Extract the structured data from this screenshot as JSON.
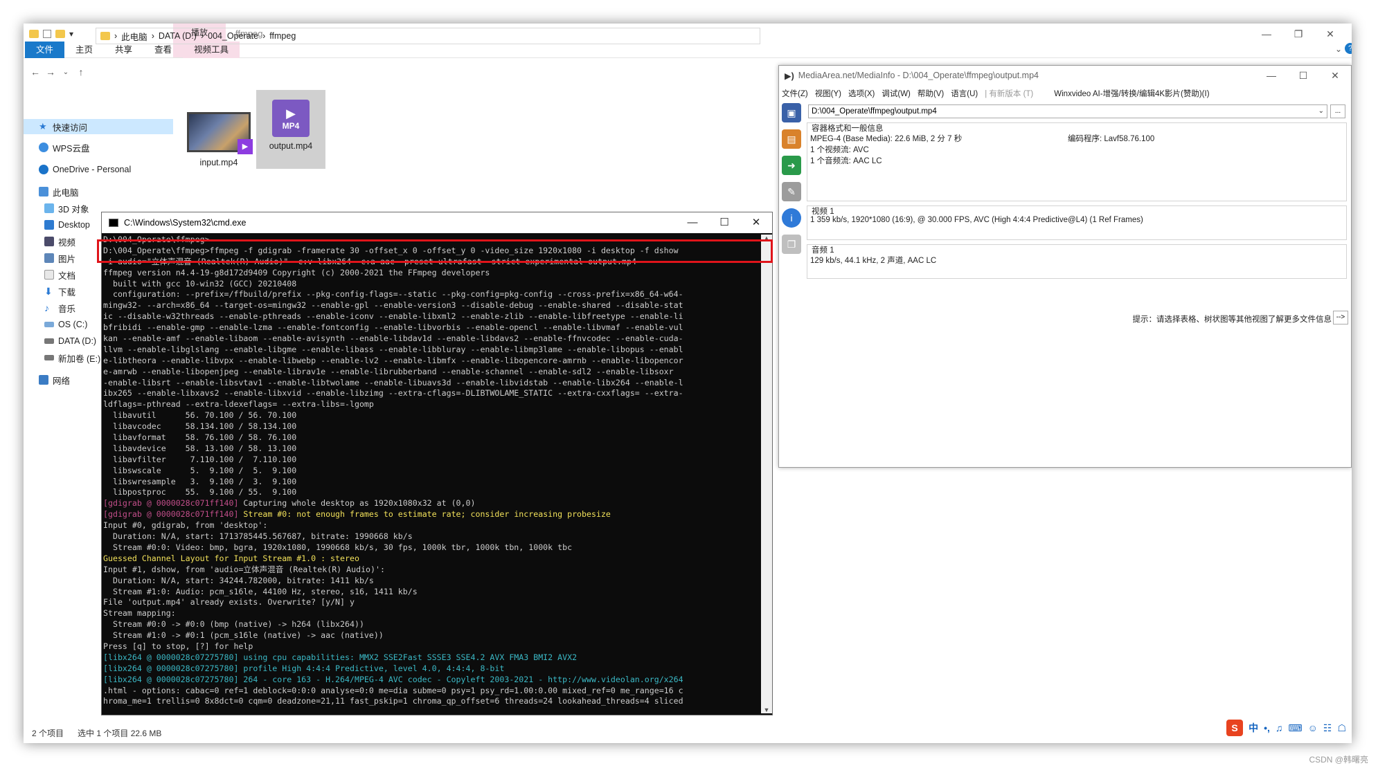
{
  "explorer": {
    "qat_chars": [
      "▾"
    ],
    "context_tab": "播放",
    "window_title": "ffmpeg",
    "controls": [
      "—",
      "❐",
      "✕"
    ],
    "ribbon_tabs": [
      "文件",
      "主页",
      "共享",
      "查看",
      "视频工具"
    ],
    "breadcrumb": [
      "此电脑",
      "DATA (D:)",
      "004_Operate",
      "ffmpeg"
    ],
    "nav": [
      {
        "label": "快速访问",
        "icon": "star-icon"
      },
      {
        "label": "WPS云盘",
        "icon": "cloud-icon"
      },
      {
        "label": "OneDrive - Personal",
        "icon": "cloud-icon"
      },
      {
        "label": "此电脑",
        "icon": "computer-icon"
      },
      {
        "label": "3D 对象",
        "icon": "cube-icon"
      },
      {
        "label": "Desktop",
        "icon": "desktop-icon"
      },
      {
        "label": "视频",
        "icon": "video-icon"
      },
      {
        "label": "图片",
        "icon": "picture-icon"
      },
      {
        "label": "文档",
        "icon": "document-icon"
      },
      {
        "label": "下载",
        "icon": "download-icon"
      },
      {
        "label": "音乐",
        "icon": "music-icon"
      },
      {
        "label": "OS (C:)",
        "icon": "drive-icon"
      },
      {
        "label": "DATA (D:)",
        "icon": "drive-icon"
      },
      {
        "label": "新加卷 (E:)",
        "icon": "drive-icon"
      },
      {
        "label": "网络",
        "icon": "network-icon"
      }
    ],
    "files": [
      {
        "name": "input.mp4",
        "badge": "▶"
      },
      {
        "name": "output.mp4",
        "badge": "MP4"
      }
    ],
    "status": [
      "2 个项目",
      "选中 1 个项目  22.6 MB"
    ]
  },
  "cmd": {
    "title": "C:\\Windows\\System32\\cmd.exe",
    "controls": [
      "—",
      "☐",
      "✕"
    ],
    "lines": [
      {
        "t": "D:\\004_Operate\\ffmpeg>",
        "c": ""
      },
      {
        "t": "D:\\004_Operate\\ffmpeg>ffmpeg -f gdigrab -framerate 30 -offset_x 0 -offset_y 0 -video_size 1920x1080 -i desktop -f dshow",
        "c": ""
      },
      {
        "t": "-i audio=\"立体声混音 (Realtek(R) Audio)\" -c:v libx264 -c:a aac -preset ultrafast -strict experimental output.mp4",
        "c": ""
      },
      {
        "t": "ffmpeg version n4.4-19-g8d172d9409 Copyright (c) 2000-2021 the FFmpeg developers",
        "c": ""
      },
      {
        "t": "  built with gcc 10-win32 (GCC) 20210408",
        "c": ""
      },
      {
        "t": "  configuration: --prefix=/ffbuild/prefix --pkg-config-flags=--static --pkg-config=pkg-config --cross-prefix=x86_64-w64-",
        "c": ""
      },
      {
        "t": "mingw32- --arch=x86_64 --target-os=mingw32 --enable-gpl --enable-version3 --disable-debug --enable-shared --disable-stat",
        "c": ""
      },
      {
        "t": "ic --disable-w32threads --enable-pthreads --enable-iconv --enable-libxml2 --enable-zlib --enable-libfreetype --enable-li",
        "c": ""
      },
      {
        "t": "bfribidi --enable-gmp --enable-lzma --enable-fontconfig --enable-libvorbis --enable-opencl --enable-libvmaf --enable-vul",
        "c": ""
      },
      {
        "t": "kan --enable-amf --enable-libaom --enable-avisynth --enable-libdav1d --enable-libdavs2 --enable-ffnvcodec --enable-cuda-",
        "c": ""
      },
      {
        "t": "llvm --enable-libglslang --enable-libgme --enable-libass --enable-libbluray --enable-libmp3lame --enable-libopus --enabl",
        "c": ""
      },
      {
        "t": "e-libtheora --enable-libvpx --enable-libwebp --enable-lv2 --enable-libmfx --enable-libopencore-amrnb --enable-libopencor",
        "c": ""
      },
      {
        "t": "e-amrwb --enable-libopenjpeg --enable-librav1e --enable-librubberband --enable-schannel --enable-sdl2 --enable-libsoxr",
        "c": ""
      },
      {
        "t": "-enable-libsrt --enable-libsvtav1 --enable-libtwolame --enable-libuavs3d --enable-libvidstab --enable-libx264 --enable-l",
        "c": ""
      },
      {
        "t": "ibx265 --enable-libxavs2 --enable-libxvid --enable-libzimg --extra-cflags=-DLIBTWOLAME_STATIC --extra-cxxflags= --extra-",
        "c": ""
      },
      {
        "t": "ldflags=-pthread --extra-ldexeflags= --extra-libs=-lgomp",
        "c": ""
      },
      {
        "t": "  libavutil      56. 70.100 / 56. 70.100",
        "c": ""
      },
      {
        "t": "  libavcodec     58.134.100 / 58.134.100",
        "c": ""
      },
      {
        "t": "  libavformat    58. 76.100 / 58. 76.100",
        "c": ""
      },
      {
        "t": "  libavdevice    58. 13.100 / 58. 13.100",
        "c": ""
      },
      {
        "t": "  libavfilter     7.110.100 /  7.110.100",
        "c": ""
      },
      {
        "t": "  libswscale      5.  9.100 /  5.  9.100",
        "c": ""
      },
      {
        "t": "  libswresample   3.  9.100 /  3.  9.100",
        "c": ""
      },
      {
        "t": "  libpostproc    55.  9.100 / 55.  9.100",
        "c": ""
      },
      {
        "t": "[gdigrab @ 0000028c071ff140] Capturing whole desktop as 1920x1080x32 at (0,0)",
        "c": "tag"
      },
      {
        "t": "[gdigrab @ 0000028c071ff140] Stream #0: not enough frames to estimate rate; consider increasing probesize",
        "c": "tagy"
      },
      {
        "t": "Input #0, gdigrab, from 'desktop':",
        "c": ""
      },
      {
        "t": "  Duration: N/A, start: 1713785445.567687, bitrate: 1990668 kb/s",
        "c": ""
      },
      {
        "t": "  Stream #0:0: Video: bmp, bgra, 1920x1080, 1990668 kb/s, 30 fps, 1000k tbr, 1000k tbn, 1000k tbc",
        "c": ""
      },
      {
        "t": "Guessed Channel Layout for Input Stream #1.0 : stereo",
        "c": "yellow"
      },
      {
        "t": "Input #1, dshow, from 'audio=立体声混音 (Realtek(R) Audio)':",
        "c": ""
      },
      {
        "t": "  Duration: N/A, start: 34244.782000, bitrate: 1411 kb/s",
        "c": ""
      },
      {
        "t": "  Stream #1:0: Audio: pcm_s16le, 44100 Hz, stereo, s16, 1411 kb/s",
        "c": ""
      },
      {
        "t": "File 'output.mp4' already exists. Overwrite? [y/N] y",
        "c": ""
      },
      {
        "t": "Stream mapping:",
        "c": ""
      },
      {
        "t": "  Stream #0:0 -> #0:0 (bmp (native) -> h264 (libx264))",
        "c": ""
      },
      {
        "t": "  Stream #1:0 -> #0:1 (pcm_s16le (native) -> aac (native))",
        "c": ""
      },
      {
        "t": "Press [q] to stop, [?] for help",
        "c": ""
      },
      {
        "t": "[libx264 @ 0000028c07275780] using cpu capabilities: MMX2 SSE2Fast SSSE3 SSE4.2 AVX FMA3 BMI2 AVX2",
        "c": "cyan"
      },
      {
        "t": "[libx264 @ 0000028c07275780] profile High 4:4:4 Predictive, level 4.0, 4:4:4, 8-bit",
        "c": "cyan"
      },
      {
        "t": "[libx264 @ 0000028c07275780] 264 - core 163 - H.264/MPEG-4 AVC codec - Copyleft 2003-2021 - http://www.videolan.org/x264",
        "c": "cyan"
      },
      {
        "t": ".html - options: cabac=0 ref=1 deblock=0:0:0 analyse=0:0 me=dia subme=0 psy=1 psy_rd=1.00:0.00 mixed_ref=0 me_range=16 c",
        "c": ""
      },
      {
        "t": "hroma_me=1 trellis=0 8x8dct=0 cqm=0 deadzone=21,11 fast_pskip=1 chroma_qp_offset=6 threads=24 lookahead_threads=4 sliced",
        "c": ""
      }
    ]
  },
  "mediainfo": {
    "title": "MediaArea.net/MediaInfo - D:\\004_Operate\\ffmpeg\\output.mp4",
    "controls": [
      "—",
      "☐",
      "✕"
    ],
    "menu": [
      "文件(Z)",
      "视图(Y)",
      "选项(X)",
      "调试(W)",
      "帮助(V)",
      "语言(U)",
      "| 有新版本 (T)",
      "Winxvideo AI-增强/转换/编辑4K影片(赞助)(I)"
    ],
    "file_path": "D:\\004_Operate\\ffmpeg\\output.mp4",
    "general_header": "容器格式和一般信息",
    "general_lines": [
      "MPEG-4 (Base Media): 22.6 MiB, 2 分 7 秒",
      "1 个视频流: AVC",
      "1 个音频流: AAC LC"
    ],
    "encoder": "编码程序: Lavf58.76.100",
    "video_header": "视频 1",
    "video_line": "1 359 kb/s, 1920*1080 (16:9), @ 30.000 FPS, AVC (High 4:4:4 Predictive@L4) (1 Ref Frames)",
    "audio_header": "音频 1",
    "audio_line": "129 kb/s, 44.1 kHz, 2 声道, AAC LC",
    "hint": "提示：请选择表格、树状图等其他视图了解更多文件信息",
    "hint_btn": "-->"
  },
  "ime": {
    "items": [
      "S",
      "中",
      "•,",
      "♫",
      "⌨",
      "☺",
      "☷",
      "☖"
    ]
  },
  "watermark": "CSDN @韩曙亮",
  "colors": {
    "file_tab": "#1979ca",
    "context_tab": "#f8dde8",
    "highlight_box": "#e0141a",
    "cmd_bg": "#0c0c0c"
  }
}
